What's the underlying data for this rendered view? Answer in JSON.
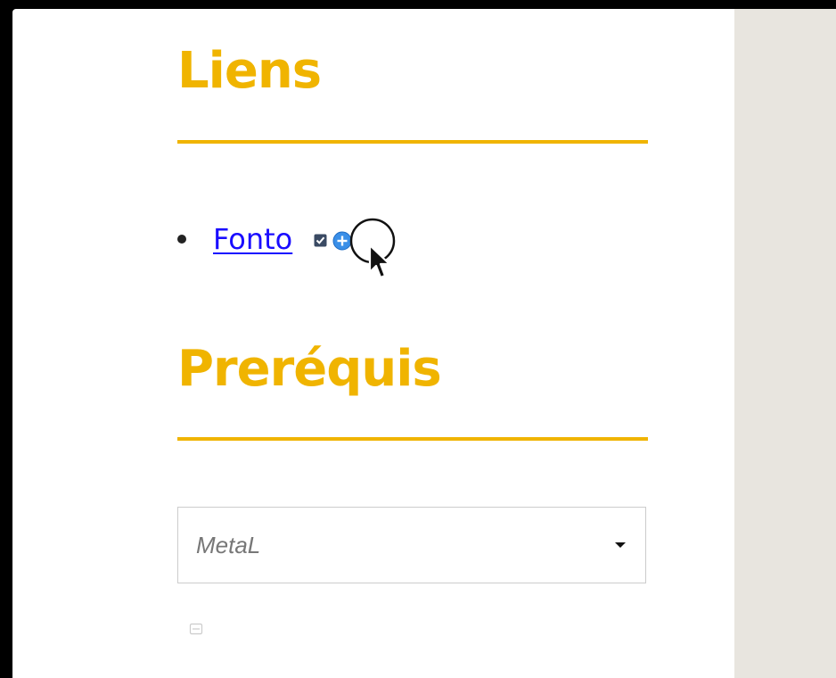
{
  "colors": {
    "accent": "#f0b400",
    "link": "#1a0dff",
    "side_panel": "#e8e5df"
  },
  "sections": {
    "links": {
      "title": "Liens",
      "items": [
        {
          "label": "Fonto",
          "icons": [
            "check-icon",
            "add-circle-icon"
          ]
        }
      ]
    },
    "prerequisites": {
      "title": "Preréquis",
      "select": {
        "value": "MetaL",
        "icon": "chevron-down-icon"
      },
      "footer_icon": "collapse-icon"
    }
  }
}
